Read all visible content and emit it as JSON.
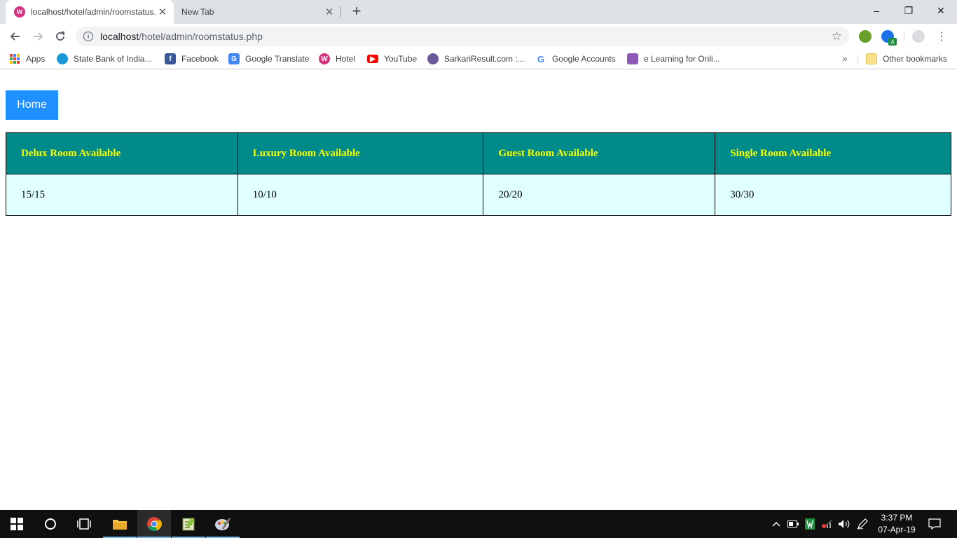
{
  "browser": {
    "tabs": [
      {
        "title": "localhost/hotel/admin/roomstatus.php",
        "active": true
      },
      {
        "title": "New Tab",
        "active": false
      }
    ],
    "new_tab_symbol": "+",
    "window_controls": {
      "minimize": "–",
      "restore": "❐",
      "close": "✕"
    },
    "url": {
      "host": "localhost",
      "path": "/hotel/admin/roomstatus.php"
    },
    "extension_badge": "4"
  },
  "bookmarks": {
    "items": [
      {
        "label": "Apps",
        "icon": "apps-grid-icon"
      },
      {
        "label": "State Bank of India...",
        "icon": "sbi-icon",
        "color": "#1a9ad7"
      },
      {
        "label": "Facebook",
        "icon": "facebook-icon",
        "color": "#3b5998"
      },
      {
        "label": "Google Translate",
        "icon": "translate-icon",
        "color": "#4285f4"
      },
      {
        "label": "Hotel",
        "icon": "hotel-icon",
        "color": "#d6307f"
      },
      {
        "label": "YouTube",
        "icon": "youtube-icon",
        "color": "#ff0000"
      },
      {
        "label": "SarkariResult.com :...",
        "icon": "sarkari-icon",
        "color": "#6a5a9a"
      },
      {
        "label": "Google Accounts",
        "icon": "google-icon",
        "color": "#4285f4"
      },
      {
        "label": "e Learning for Onli...",
        "icon": "elearning-icon",
        "color": "#8e5ab5"
      }
    ],
    "overflow": "»",
    "other": "Other bookmarks"
  },
  "page": {
    "home_button": "Home",
    "table": {
      "headers": [
        "Delux Room Available",
        "Luxury Room Available",
        "Guest Room Available",
        "Single Room Available"
      ],
      "values": [
        "15/15",
        "10/10",
        "20/20",
        "30/30"
      ]
    },
    "colors": {
      "header_bg": "#008b8b",
      "header_text": "#ffff00",
      "cell_bg": "#e0ffff",
      "home_bg": "#1e90ff"
    }
  },
  "taskbar": {
    "clock_time": "3:37 PM",
    "clock_date": "07-Apr-19"
  }
}
